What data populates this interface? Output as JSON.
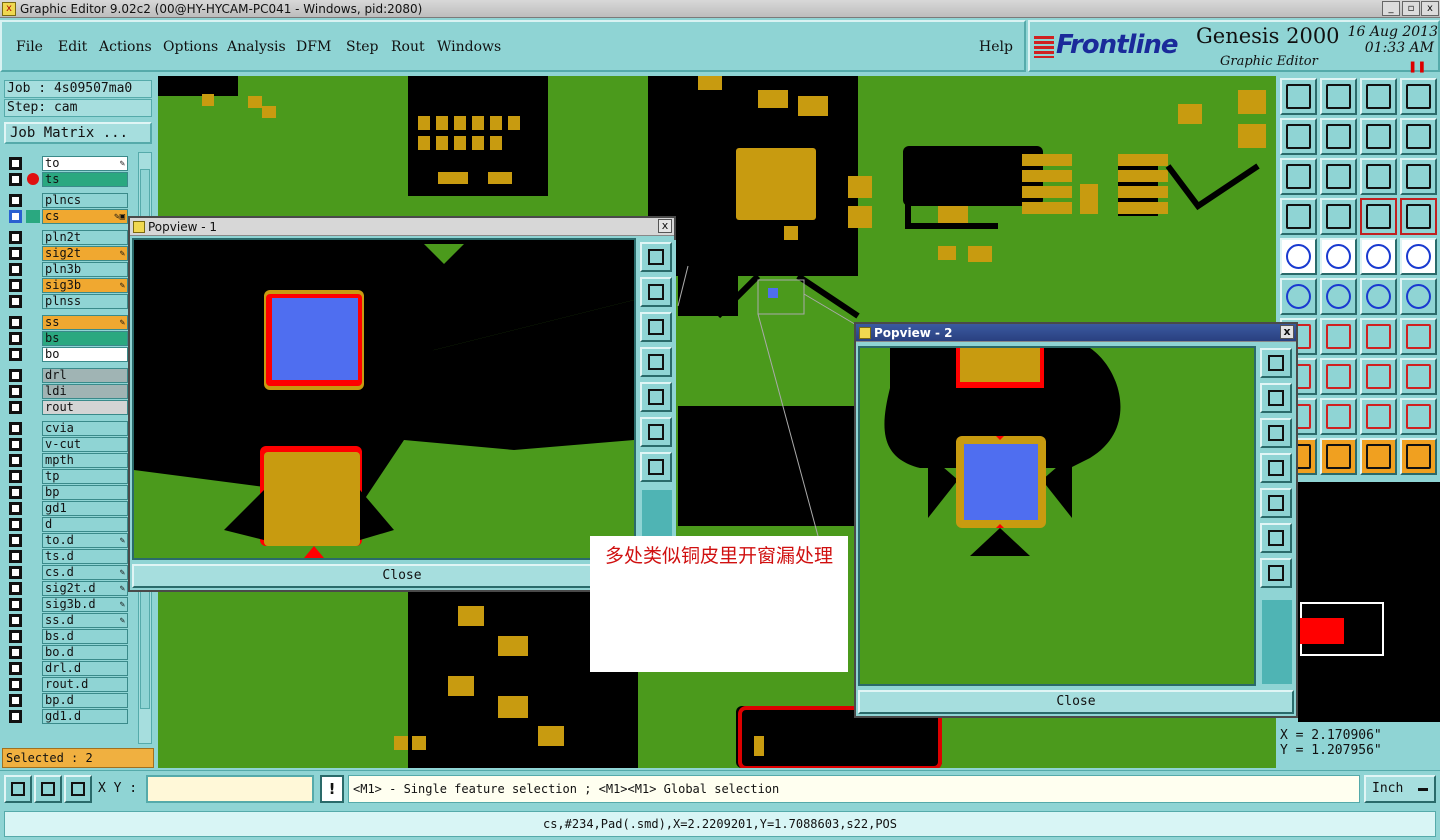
{
  "window": {
    "title": "Graphic Editor 9.02c2 (00@HY-HYCAM-PC041 - Windows, pid:2080)"
  },
  "menu": {
    "items": [
      {
        "label": "File"
      },
      {
        "label": "Edit"
      },
      {
        "label": "Actions"
      },
      {
        "label": "Options"
      },
      {
        "label": "Analysis"
      },
      {
        "label": "DFM"
      },
      {
        "label": "Step"
      },
      {
        "label": "Rout"
      },
      {
        "label": "Windows"
      }
    ],
    "help": "Help"
  },
  "brand": {
    "logo": "Frontline",
    "product": "Genesis 2000",
    "subtitle": "Graphic Editor",
    "date": "16 Aug 2013",
    "time": "01:33 AM"
  },
  "job": {
    "job_label": "Job : 4s09507ma0",
    "step_label": "Step: cam",
    "matrix_button": "Job Matrix ..."
  },
  "layers": [
    {
      "name": "to",
      "color": "#ffffff",
      "flag": "edit"
    },
    {
      "name": "ts",
      "color": "#2aa880",
      "flag": "",
      "marker": "red-dot"
    },
    {
      "name": "plncs",
      "color": "#8fd4d4",
      "flag": ""
    },
    {
      "name": "cs",
      "color": "#f0a830",
      "flag": "edit-work",
      "marker": "work-icon"
    },
    {
      "name": "pln2t",
      "color": "#8fd4d4",
      "flag": ""
    },
    {
      "name": "sig2t",
      "color": "#f0a830",
      "flag": "edit"
    },
    {
      "name": "pln3b",
      "color": "#8fd4d4",
      "flag": ""
    },
    {
      "name": "sig3b",
      "color": "#f0a830",
      "flag": "edit"
    },
    {
      "name": "plnss",
      "color": "#8fd4d4",
      "flag": ""
    },
    {
      "name": "ss",
      "color": "#f0a830",
      "flag": "edit"
    },
    {
      "name": "bs",
      "color": "#2aa880",
      "flag": ""
    },
    {
      "name": "bo",
      "color": "#ffffff",
      "flag": ""
    },
    {
      "name": "drl",
      "color": "#a0b4b4",
      "flag": ""
    },
    {
      "name": "ldi",
      "color": "#a0b4b4",
      "flag": ""
    },
    {
      "name": "rout",
      "color": "#d4d4d4",
      "flag": ""
    },
    {
      "name": "cvia",
      "color": "#8fd4d4",
      "flag": ""
    },
    {
      "name": "v-cut",
      "color": "#8fd4d4",
      "flag": ""
    },
    {
      "name": "mpth",
      "color": "#8fd4d4",
      "flag": ""
    },
    {
      "name": "tp",
      "color": "#8fd4d4",
      "flag": ""
    },
    {
      "name": "bp",
      "color": "#8fd4d4",
      "flag": ""
    },
    {
      "name": "gd1",
      "color": "#8fd4d4",
      "flag": ""
    },
    {
      "name": "d",
      "color": "#8fd4d4",
      "flag": ""
    },
    {
      "name": "to.d",
      "color": "#8fd4d4",
      "flag": "edit"
    },
    {
      "name": "ts.d",
      "color": "#8fd4d4",
      "flag": ""
    },
    {
      "name": "cs.d",
      "color": "#8fd4d4",
      "flag": "edit"
    },
    {
      "name": "sig2t.d",
      "color": "#8fd4d4",
      "flag": "edit"
    },
    {
      "name": "sig3b.d",
      "color": "#8fd4d4",
      "flag": "edit"
    },
    {
      "name": "ss.d",
      "color": "#8fd4d4",
      "flag": "edit"
    },
    {
      "name": "bs.d",
      "color": "#8fd4d4",
      "flag": ""
    },
    {
      "name": "bo.d",
      "color": "#8fd4d4",
      "flag": ""
    },
    {
      "name": "drl.d",
      "color": "#8fd4d4",
      "flag": ""
    },
    {
      "name": "rout.d",
      "color": "#8fd4d4",
      "flag": ""
    },
    {
      "name": "bp.d",
      "color": "#8fd4d4",
      "flag": ""
    },
    {
      "name": "gd1.d",
      "color": "#8fd4d4",
      "flag": ""
    }
  ],
  "selection": {
    "label": "Selected : 2"
  },
  "popview1": {
    "title": "Popview - 1",
    "close_label": "Close"
  },
  "popview2": {
    "title": "Popview - 2",
    "close_label": "Close"
  },
  "annotation": {
    "text": "多处类似铜皮里开窗漏处理"
  },
  "coords": {
    "x": "X = 2.170906\"",
    "y": "Y = 1.207956\""
  },
  "command": {
    "xy_label": "X Y :",
    "xy_value": "",
    "excl": "!",
    "hint": "<M1> - Single feature selection ; <M1><M1> Global selection",
    "units": "Inch"
  },
  "status": {
    "text": "cs,#234,Pad(.smd),X=2.2209201,Y=1.7088603,s22,POS"
  },
  "colors": {
    "copper": "#c89b10",
    "board_green": "#4b9a1c",
    "highlight_pad": "#4f6ef0",
    "panel_teal": "#8fd4d4"
  }
}
